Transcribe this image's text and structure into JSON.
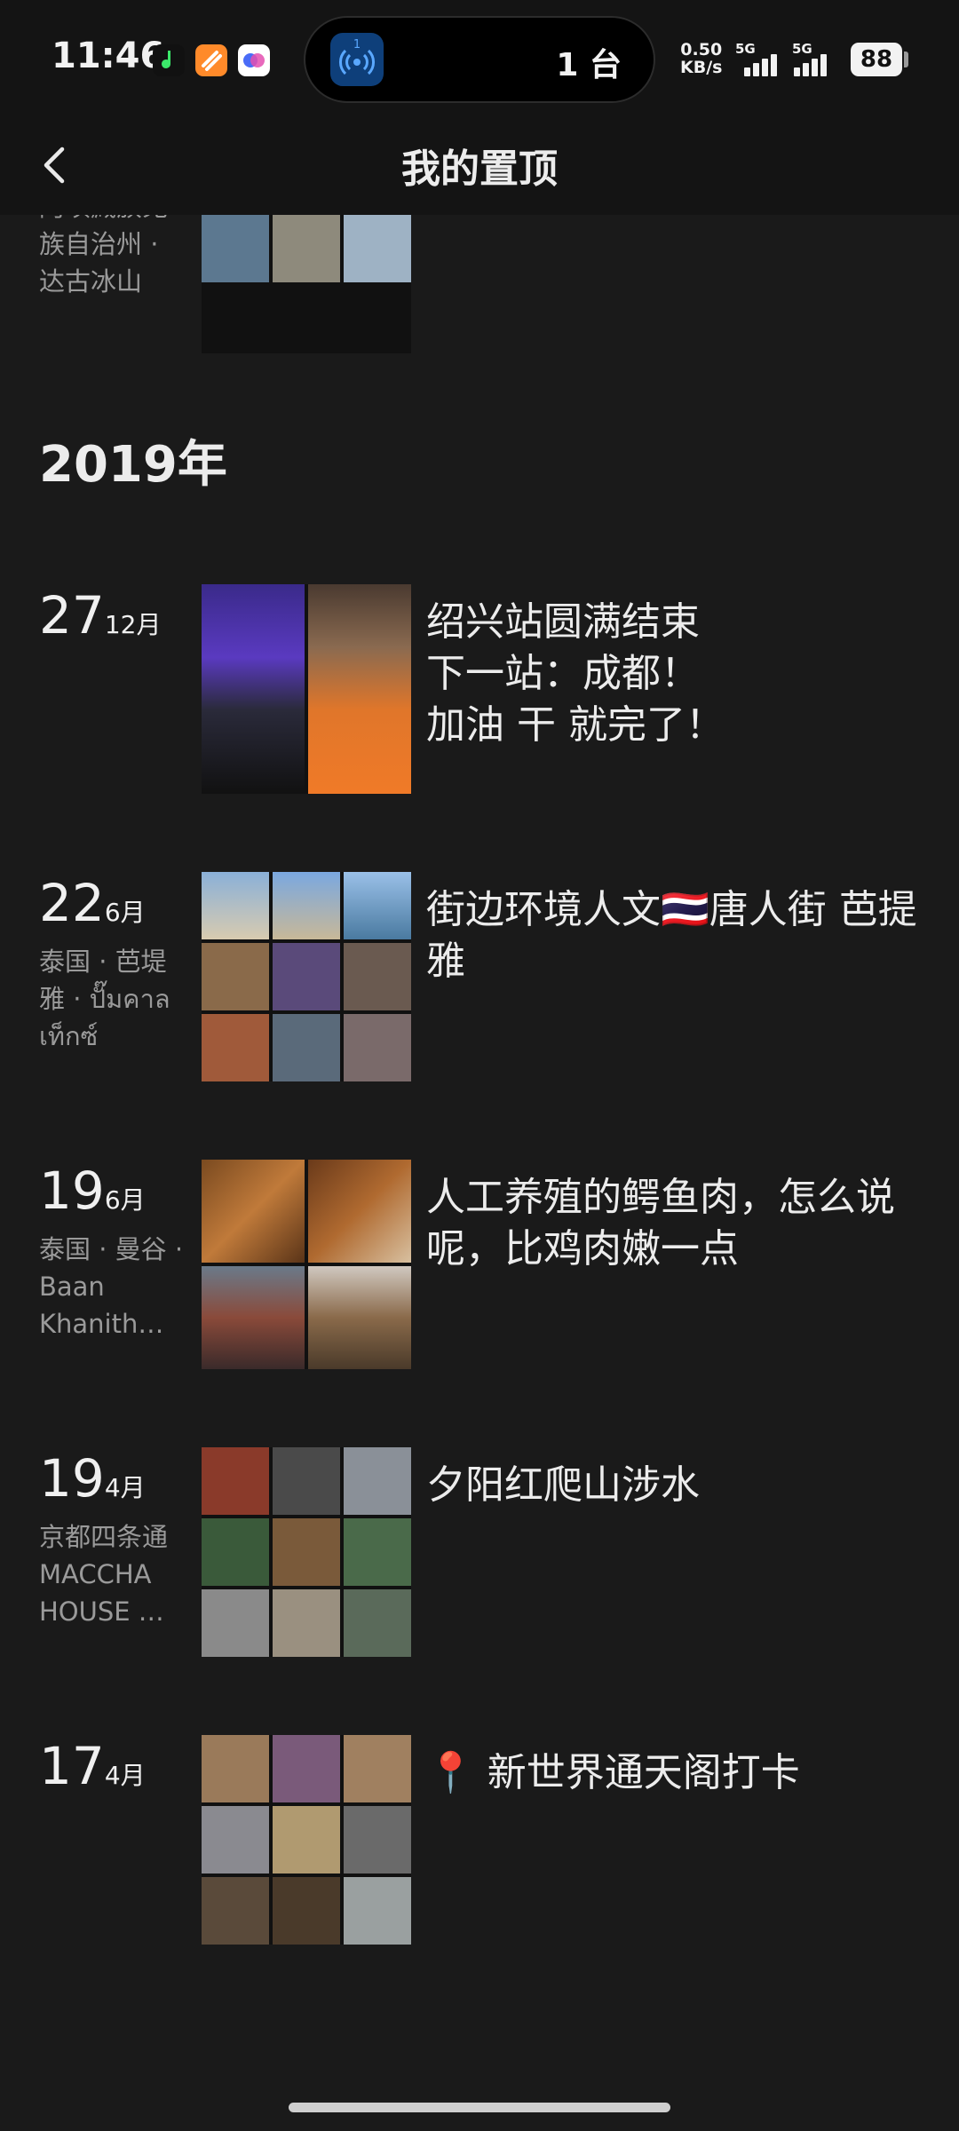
{
  "status_bar": {
    "time": "11:46",
    "island_text": "1 台",
    "net_speed_value": "0.50",
    "net_speed_unit": "KB/s",
    "signal_1_label": "5G",
    "signal_2_label": "5G",
    "battery": "88"
  },
  "header": {
    "title": "我的置顶",
    "back_icon": "chevron-left-icon"
  },
  "partial_entry": {
    "location": "阿坝藏族羌族自治州 · 达古冰山"
  },
  "year": "2019年",
  "entries": [
    {
      "day": "27",
      "month": "12月",
      "location": "",
      "caption": "绍兴站圆满结束\n下一站：成都！\n加油 干 就完了！"
    },
    {
      "day": "22",
      "month": "6月",
      "location": "泰国 · 芭堤雅 · ปั๊มคาลเท็กซ์",
      "caption": "街边环境人文🇹🇭唐人街 芭提雅"
    },
    {
      "day": "19",
      "month": "6月",
      "location": "泰国 · 曼谷 · Baan Khanith…",
      "caption": "人工养殖的鳄鱼肉，怎么说呢，比鸡肉嫩一点"
    },
    {
      "day": "19",
      "month": "4月",
      "location": "京都四条通MACCHA HOUSE …",
      "caption": "夕阳红爬山涉水"
    },
    {
      "day": "17",
      "month": "4月",
      "location": "",
      "caption": "📍 新世界通天阁打卡"
    }
  ]
}
